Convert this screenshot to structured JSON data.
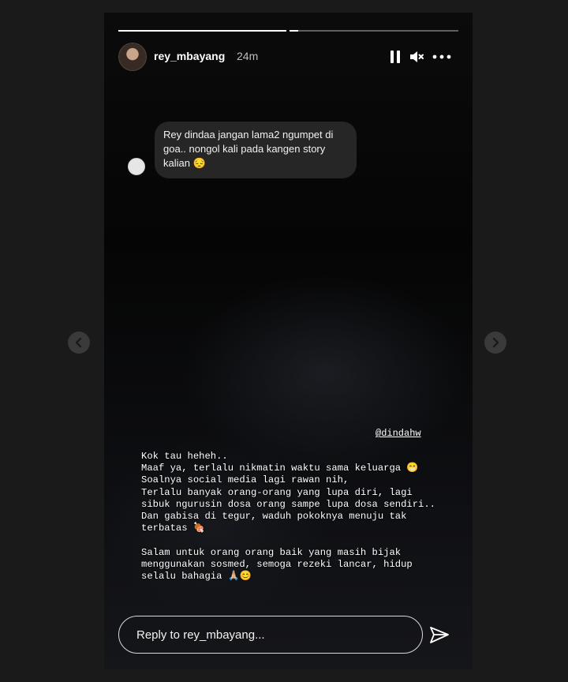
{
  "story": {
    "username": "rey_mbayang",
    "time": "24m",
    "progress": [
      1.0,
      0.05
    ]
  },
  "question": {
    "text": "Rey dindaa jangan lama2 ngumpet di goa.. nongol kali pada kangen story kalian 😔"
  },
  "mention": "@dindahw",
  "caption": "Kok tau heheh..\nMaaf ya, terlalu nikmatin waktu sama keluarga 😁\nSoalnya social media lagi rawan nih,\nTerlalu banyak orang-orang yang lupa diri, lagi\nsibuk ngurusin dosa orang sampe lupa dosa sendiri..\nDan gabisa di tegur, waduh pokoknya menuju tak\nterbatas 🍖\n\nSalam untuk orang orang baik yang masih bijak\nmenggunakan sosmed, semoga rezeki lancar, hidup\nselalu bahagia 🙏🏼😊",
  "reply": {
    "placeholder": "Reply to rey_mbayang..."
  },
  "icons": {
    "pause": "pause-icon",
    "mute": "volume-muted-icon",
    "more": "more-icon",
    "send": "send-icon",
    "prev": "chevron-left-icon",
    "next": "chevron-right-icon"
  }
}
